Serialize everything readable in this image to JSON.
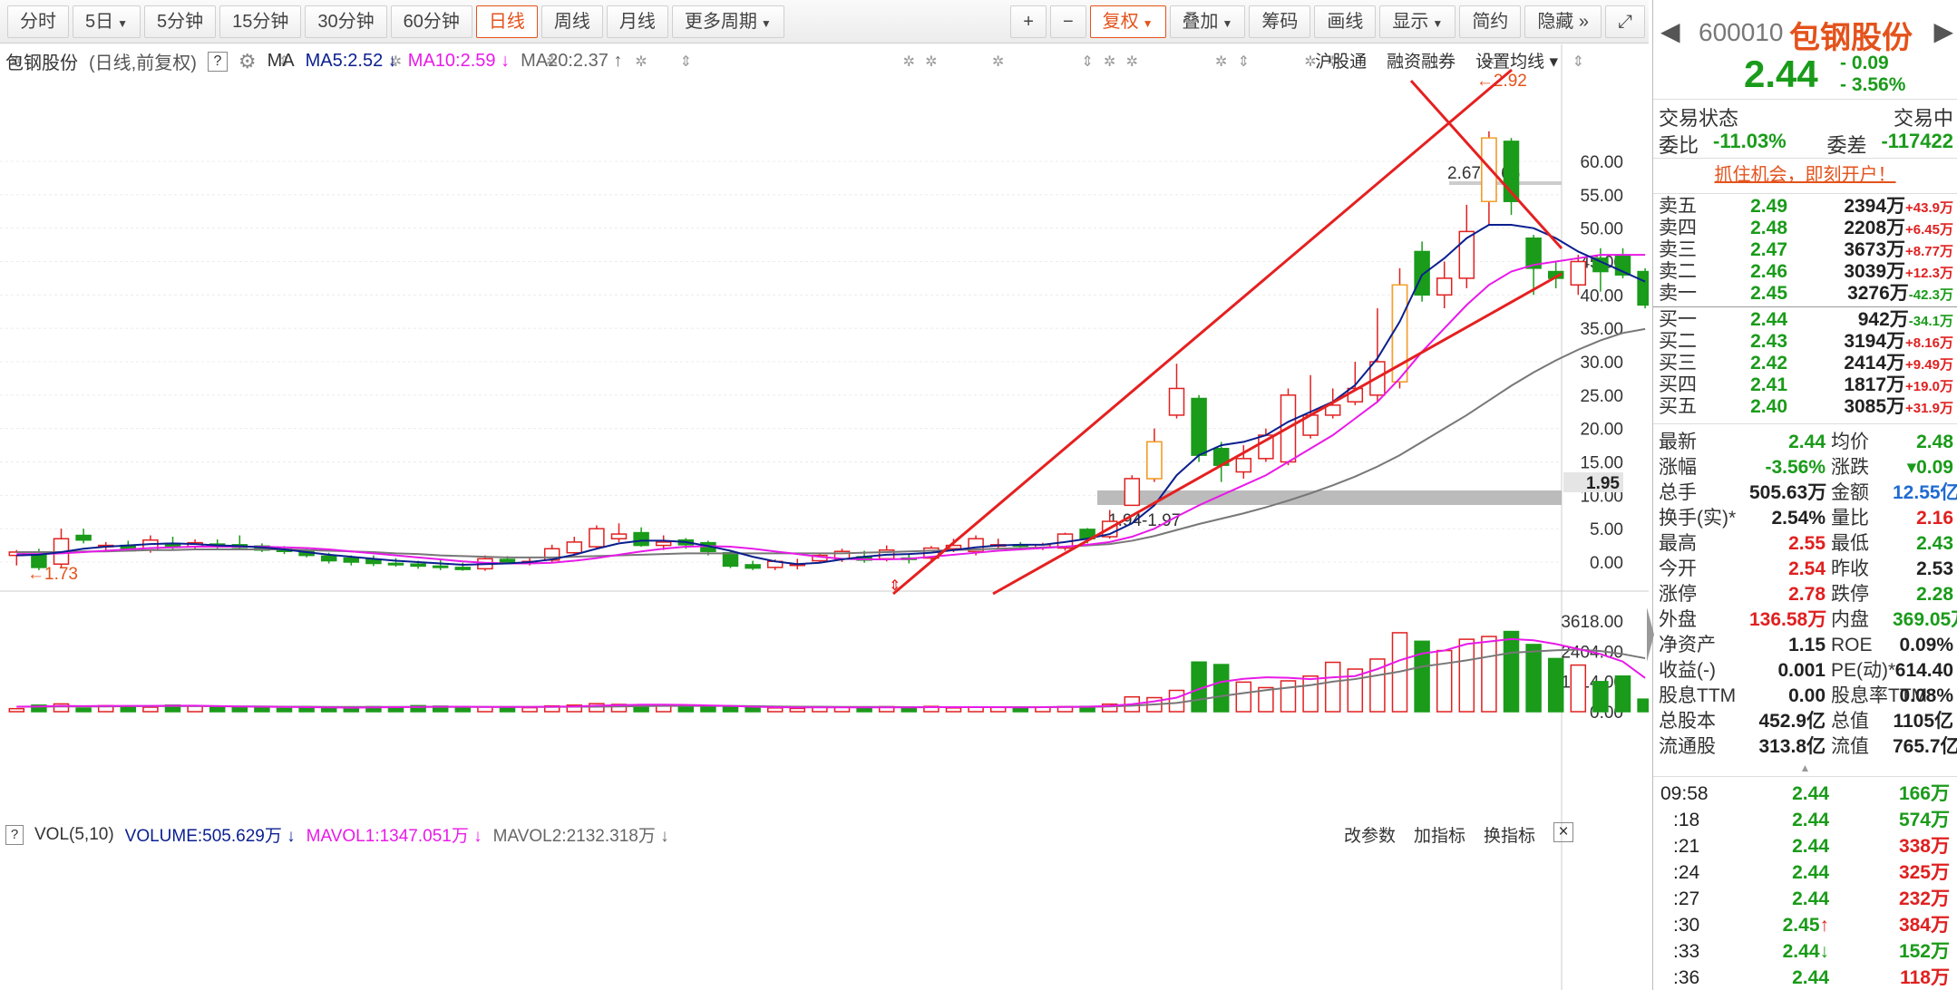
{
  "toolbar": {
    "periods": [
      {
        "label": "分时",
        "caret": false
      },
      {
        "label": "5日",
        "caret": true
      },
      {
        "label": "5分钟",
        "caret": false
      },
      {
        "label": "15分钟",
        "caret": false
      },
      {
        "label": "30分钟",
        "caret": false
      },
      {
        "label": "60分钟",
        "caret": false
      },
      {
        "label": "日线",
        "caret": false,
        "active": true
      },
      {
        "label": "周线",
        "caret": false
      },
      {
        "label": "月线",
        "caret": false
      },
      {
        "label": "更多周期",
        "caret": true
      }
    ],
    "right": [
      {
        "label": "+",
        "caret": false
      },
      {
        "label": "−",
        "caret": false
      },
      {
        "label": "复权",
        "caret": true,
        "active": true
      },
      {
        "label": "叠加",
        "caret": true
      },
      {
        "label": "筹码",
        "caret": false
      },
      {
        "label": "画线",
        "caret": false
      },
      {
        "label": "显示",
        "caret": true
      },
      {
        "label": "简约",
        "caret": false
      },
      {
        "label": "隐藏 »",
        "caret": false
      },
      {
        "label": "⤢",
        "caret": false
      }
    ]
  },
  "legend": {
    "stock": "包钢股份",
    "mode": "(日线,前复权)",
    "help": "?",
    "ma_label": "MA",
    "ma5": "MA5:2.52 ↓",
    "ma10": "MA10:2.59 ↓",
    "ma20": "MA20:2.37 ↑",
    "links": [
      "沪股通",
      "融资融券",
      "设置均线 ▾"
    ]
  },
  "vol_legend": {
    "help": "?",
    "name": "VOL(5,10)",
    "volume": "VOLUME:505.629万 ↓",
    "mavol1": "MAVOL1:1347.051万 ↓",
    "mavol2": "MAVOL2:2132.318万 ↓",
    "links": [
      "改参数",
      "加指标",
      "换指标"
    ],
    "close": "×"
  },
  "chart_data": {
    "type": "candlestick",
    "price_axis": {
      "ticks": [
        0,
        5,
        10,
        15,
        20,
        25,
        30,
        35,
        40,
        45,
        50,
        55,
        60
      ],
      "labels": [
        "0.00",
        "5.00",
        "10.00",
        "15.00",
        "20.00",
        "25.00",
        "30.00",
        "35.00",
        "40.00",
        "45.00",
        "50.00",
        "55.00",
        "60.00"
      ]
    },
    "volume_axis": {
      "ticks": [
        0,
        1214,
        2404,
        3618
      ],
      "labels": [
        "0.00",
        "1214.00",
        "2404.00",
        "3618.00"
      ]
    },
    "current_price_tag": "1.95",
    "annotations": {
      "low_label": "←1.73",
      "high_label": "←2.92",
      "gap_upper": "2.67-2.66",
      "gap_lower": "1.94-1.97"
    },
    "candles": [
      {
        "o": 1.0,
        "h": 1.8,
        "l": -0.5,
        "c": 1.5
      },
      {
        "o": 1.0,
        "h": 2.0,
        "l": -1.2,
        "c": -0.8
      },
      {
        "o": -0.3,
        "h": 5.0,
        "l": -0.8,
        "c": 3.5
      },
      {
        "o": 4.0,
        "h": 5.0,
        "l": 2.8,
        "c": 3.3
      },
      {
        "o": 2.3,
        "h": 3.0,
        "l": 1.8,
        "c": 2.5
      },
      {
        "o": 2.5,
        "h": 3.2,
        "l": 1.6,
        "c": 1.7
      },
      {
        "o": 1.8,
        "h": 4.0,
        "l": 1.4,
        "c": 3.3
      },
      {
        "o": 2.8,
        "h": 3.8,
        "l": 1.8,
        "c": 2.2
      },
      {
        "o": 2.3,
        "h": 3.4,
        "l": 1.8,
        "c": 2.9
      },
      {
        "o": 2.7,
        "h": 3.4,
        "l": 1.9,
        "c": 2.5
      },
      {
        "o": 2.6,
        "h": 4.0,
        "l": 1.9,
        "c": 2.2
      },
      {
        "o": 2.4,
        "h": 2.8,
        "l": 1.5,
        "c": 1.8
      },
      {
        "o": 1.9,
        "h": 2.4,
        "l": 1.2,
        "c": 1.6
      },
      {
        "o": 1.6,
        "h": 2.2,
        "l": 0.7,
        "c": 1.0
      },
      {
        "o": 0.9,
        "h": 1.4,
        "l": -0.2,
        "c": 0.2
      },
      {
        "o": 0.6,
        "h": 1.0,
        "l": -0.5,
        "c": 0.0
      },
      {
        "o": 0.4,
        "h": 1.0,
        "l": -0.6,
        "c": -0.2
      },
      {
        "o": -0.2,
        "h": 0.6,
        "l": -0.7,
        "c": -0.4
      },
      {
        "o": -0.3,
        "h": 0.2,
        "l": -1.0,
        "c": -0.6
      },
      {
        "o": -0.6,
        "h": 0.5,
        "l": -1.2,
        "c": -0.8
      },
      {
        "o": -0.8,
        "h": -0.1,
        "l": -1.3,
        "c": -1.1
      },
      {
        "o": -1.0,
        "h": 1.0,
        "l": -1.3,
        "c": 0.5
      },
      {
        "o": 0.4,
        "h": 0.9,
        "l": -0.3,
        "c": -0.2
      },
      {
        "o": -0.1,
        "h": 0.8,
        "l": -0.5,
        "c": 0.1
      },
      {
        "o": 0.3,
        "h": 2.6,
        "l": -0.2,
        "c": 2.0
      },
      {
        "o": 1.4,
        "h": 3.8,
        "l": 1.0,
        "c": 3.0
      },
      {
        "o": 2.3,
        "h": 5.5,
        "l": 2.0,
        "c": 5.0
      },
      {
        "o": 3.5,
        "h": 5.8,
        "l": 3.0,
        "c": 4.2
      },
      {
        "o": 4.4,
        "h": 5.2,
        "l": 2.3,
        "c": 2.5
      },
      {
        "o": 2.5,
        "h": 4.0,
        "l": 1.8,
        "c": 3.0
      },
      {
        "o": 3.3,
        "h": 3.6,
        "l": 2.0,
        "c": 2.6
      },
      {
        "o": 2.9,
        "h": 3.2,
        "l": 1.0,
        "c": 1.6
      },
      {
        "o": 1.4,
        "h": 1.8,
        "l": -0.9,
        "c": -0.6
      },
      {
        "o": -0.4,
        "h": 0.2,
        "l": -1.2,
        "c": -0.9
      },
      {
        "o": -0.8,
        "h": 0.4,
        "l": -1.2,
        "c": 0.1
      },
      {
        "o": -0.5,
        "h": 0.5,
        "l": -1.1,
        "c": -0.3
      },
      {
        "o": 0.2,
        "h": 1.2,
        "l": -0.2,
        "c": 1.0
      },
      {
        "o": 0.5,
        "h": 2.0,
        "l": 0.0,
        "c": 1.6
      },
      {
        "o": 0.8,
        "h": 1.7,
        "l": -0.1,
        "c": 0.3
      },
      {
        "o": 0.5,
        "h": 2.5,
        "l": 0.1,
        "c": 1.8
      },
      {
        "o": 0.6,
        "h": 1.3,
        "l": -0.2,
        "c": 0.4
      },
      {
        "o": 0.6,
        "h": 2.4,
        "l": 0.2,
        "c": 2.1
      },
      {
        "o": 2.0,
        "h": 3.5,
        "l": 1.5,
        "c": 2.5
      },
      {
        "o": 1.6,
        "h": 4.0,
        "l": 1.0,
        "c": 3.5
      },
      {
        "o": 2.4,
        "h": 3.5,
        "l": 1.9,
        "c": 2.6
      },
      {
        "o": 2.6,
        "h": 3.0,
        "l": 2.2,
        "c": 2.5
      },
      {
        "o": 2.2,
        "h": 2.9,
        "l": 1.8,
        "c": 2.6
      },
      {
        "o": 2.1,
        "h": 4.4,
        "l": 1.7,
        "c": 4.2
      },
      {
        "o": 4.9,
        "h": 5.1,
        "l": 2.8,
        "c": 3.5
      },
      {
        "o": 3.8,
        "h": 7.8,
        "l": 3.5,
        "c": 6.1
      },
      {
        "o": 8.5,
        "h": 13.0,
        "l": 8.5,
        "c": 12.5
      },
      {
        "o": 12.5,
        "h": 20.0,
        "l": 12.0,
        "c": 18.0
      },
      {
        "o": 22.0,
        "h": 29.7,
        "l": 21.5,
        "c": 26.0
      },
      {
        "o": 24.5,
        "h": 25.0,
        "l": 15.0,
        "c": 16.0
      },
      {
        "o": 17.0,
        "h": 18.0,
        "l": 12.0,
        "c": 14.5
      },
      {
        "o": 13.5,
        "h": 17.5,
        "l": 12.5,
        "c": 15.5
      },
      {
        "o": 15.5,
        "h": 20.0,
        "l": 15.0,
        "c": 19.0
      },
      {
        "o": 15.0,
        "h": 26.0,
        "l": 14.5,
        "c": 25.0
      },
      {
        "o": 19.0,
        "h": 28.0,
        "l": 18.5,
        "c": 22.0
      },
      {
        "o": 22.0,
        "h": 26.0,
        "l": 21.5,
        "c": 23.5
      },
      {
        "o": 24.0,
        "h": 30.0,
        "l": 23.5,
        "c": 26.0
      },
      {
        "o": 25.0,
        "h": 38.0,
        "l": 24.0,
        "c": 30.0
      },
      {
        "o": 27.0,
        "h": 44.0,
        "l": 26.0,
        "c": 41.5
      },
      {
        "o": 46.5,
        "h": 48.0,
        "l": 39.0,
        "c": 40.0
      },
      {
        "o": 40.0,
        "h": 45.0,
        "l": 38.0,
        "c": 42.5
      },
      {
        "o": 42.5,
        "h": 53.5,
        "l": 41.0,
        "c": 49.5
      },
      {
        "o": 54.0,
        "h": 64.5,
        "l": 50.5,
        "c": 63.5
      },
      {
        "o": 63.0,
        "h": 63.5,
        "l": 52.0,
        "c": 54.0
      },
      {
        "o": 48.5,
        "h": 49.0,
        "l": 40.0,
        "c": 44.0
      },
      {
        "o": 43.5,
        "h": 45.0,
        "l": 41.0,
        "c": 42.5
      },
      {
        "o": 41.5,
        "h": 46.0,
        "l": 40.0,
        "c": 45.0
      },
      {
        "o": 45.5,
        "h": 47.0,
        "l": 40.5,
        "c": 43.5
      },
      {
        "o": 46.0,
        "h": 47.0,
        "l": 42.5,
        "c": 43.0
      },
      {
        "o": 43.5,
        "h": 44.0,
        "l": 38.0,
        "c": 38.5
      }
    ],
    "ma5": [
      1.0,
      1.1,
      1.5,
      2.0,
      2.3,
      2.5,
      2.7,
      2.8,
      2.7,
      2.5,
      2.4,
      2.2,
      1.9,
      1.5,
      1.1,
      0.8,
      0.5,
      0.2,
      0.0,
      -0.2,
      -0.4,
      -0.3,
      -0.2,
      0.0,
      0.4,
      1.1,
      2.0,
      2.8,
      3.2,
      3.2,
      3.0,
      2.4,
      1.7,
      0.8,
      0.1,
      -0.3,
      -0.1,
      0.4,
      0.8,
      1.1,
      1.2,
      1.4,
      1.8,
      2.2,
      2.5,
      2.6,
      2.6,
      3.0,
      3.5,
      4.2,
      5.8,
      8.5,
      13.0,
      16.0,
      17.5,
      18.0,
      19.0,
      21.0,
      22.5,
      24.0,
      26.5,
      30.5,
      36.0,
      43.0,
      45.5,
      48.5,
      50.5,
      50.5,
      50.0,
      48.5,
      46.5,
      45.0,
      43.5,
      42.0
    ],
    "ma10": [
      1.2,
      1.2,
      1.3,
      1.5,
      1.7,
      1.9,
      2.1,
      2.2,
      2.3,
      2.3,
      2.3,
      2.3,
      2.2,
      2.1,
      1.9,
      1.6,
      1.3,
      1.0,
      0.7,
      0.4,
      0.1,
      -0.1,
      -0.2,
      -0.2,
      -0.1,
      0.2,
      0.6,
      1.1,
      1.6,
      2.0,
      2.3,
      2.4,
      2.3,
      2.0,
      1.6,
      1.2,
      0.8,
      0.5,
      0.4,
      0.4,
      0.5,
      0.8,
      1.1,
      1.4,
      1.7,
      1.9,
      2.1,
      2.3,
      2.6,
      3.0,
      3.8,
      5.0,
      6.8,
      8.5,
      10.0,
      11.5,
      13.0,
      15.0,
      17.0,
      19.0,
      21.5,
      24.0,
      27.5,
      31.5,
      35.0,
      38.5,
      41.5,
      43.5,
      44.5,
      45.0,
      45.5,
      46.0,
      46.0,
      46.0
    ],
    "ma20": [
      1.5,
      1.5,
      1.5,
      1.6,
      1.6,
      1.7,
      1.8,
      1.8,
      1.9,
      1.9,
      1.9,
      1.9,
      1.9,
      1.8,
      1.7,
      1.6,
      1.5,
      1.3,
      1.2,
      1.0,
      0.9,
      0.8,
      0.7,
      0.7,
      0.7,
      0.8,
      0.9,
      1.0,
      1.1,
      1.2,
      1.3,
      1.3,
      1.3,
      1.3,
      1.3,
      1.3,
      1.3,
      1.3,
      1.4,
      1.5,
      1.6,
      1.7,
      1.8,
      1.9,
      2.0,
      2.1,
      2.2,
      2.3,
      2.5,
      2.7,
      3.2,
      3.9,
      4.8,
      5.7,
      6.5,
      7.3,
      8.2,
      9.2,
      10.3,
      11.5,
      12.8,
      14.3,
      16.0,
      18.0,
      20.0,
      22.0,
      24.2,
      26.4,
      28.4,
      30.2,
      31.8,
      33.2,
      34.3,
      34.9
    ],
    "volume": [
      120,
      260,
      310,
      140,
      240,
      220,
      180,
      260,
      230,
      200,
      180,
      150,
      130,
      170,
      150,
      130,
      200,
      180,
      240,
      220,
      160,
      190,
      180,
      160,
      230,
      260,
      320,
      290,
      280,
      250,
      210,
      220,
      200,
      160,
      150,
      130,
      180,
      180,
      150,
      200,
      160,
      210,
      150,
      180,
      170,
      150,
      190,
      200,
      210,
      300,
      590,
      560,
      850,
      1980,
      1880,
      1180,
      960,
      1230,
      1420,
      1970,
      1700,
      2100,
      3150,
      2810,
      2440,
      2890,
      3000,
      3200,
      2680,
      2120,
      1860,
      1200,
      1420,
      500
    ],
    "mavol1": [
      200,
      210,
      230,
      220,
      230,
      230,
      230,
      240,
      240,
      220,
      210,
      200,
      190,
      180,
      170,
      160,
      170,
      180,
      190,
      200,
      200,
      190,
      190,
      190,
      200,
      210,
      240,
      260,
      280,
      280,
      270,
      250,
      230,
      200,
      180,
      170,
      170,
      170,
      170,
      170,
      170,
      180,
      180,
      180,
      180,
      170,
      180,
      190,
      200,
      230,
      300,
      410,
      560,
      900,
      1190,
      1310,
      1370,
      1350,
      1300,
      1370,
      1420,
      1700,
      2050,
      2320,
      2440,
      2700,
      2800,
      2900,
      2850,
      2700,
      2500,
      2300,
      2000,
      1347
    ],
    "mavol2": [
      200,
      200,
      210,
      210,
      210,
      220,
      220,
      220,
      220,
      220,
      210,
      210,
      200,
      200,
      190,
      190,
      190,
      190,
      190,
      190,
      190,
      190,
      190,
      190,
      190,
      200,
      200,
      210,
      220,
      230,
      230,
      230,
      230,
      220,
      210,
      200,
      200,
      190,
      190,
      190,
      180,
      180,
      180,
      180,
      180,
      180,
      180,
      190,
      190,
      210,
      240,
      290,
      350,
      480,
      620,
      740,
      860,
      960,
      1060,
      1200,
      1300,
      1450,
      1600,
      1800,
      1920,
      2050,
      2200,
      2350,
      2400,
      2450,
      2480,
      2420,
      2300,
      2132
    ]
  },
  "quote": {
    "code": "600010",
    "name": "包钢股份",
    "price": "2.44",
    "change": "- 0.09",
    "change_pct": "- 3.56%",
    "trade_status_label": "交易状态",
    "trade_status": "交易中",
    "weibi_label": "委比",
    "weibi": "-11.03%",
    "weicha_label": "委差",
    "weicha": "-117422",
    "promo": "抓住机会，即刻开户！",
    "asks": [
      {
        "label": "卖五",
        "price": "2.49",
        "vol": "2394万",
        "delta": "+43.9万",
        "up": true
      },
      {
        "label": "卖四",
        "price": "2.48",
        "vol": "2208万",
        "delta": "+6.45万",
        "up": true
      },
      {
        "label": "卖三",
        "price": "2.47",
        "vol": "3673万",
        "delta": "+8.77万",
        "up": true
      },
      {
        "label": "卖二",
        "price": "2.46",
        "vol": "3039万",
        "delta": "+12.3万",
        "up": true
      },
      {
        "label": "卖一",
        "price": "2.45",
        "vol": "3276万",
        "delta": "-42.3万",
        "up": false
      }
    ],
    "bids": [
      {
        "label": "买一",
        "price": "2.44",
        "vol": "942万",
        "delta": "-34.1万",
        "up": false
      },
      {
        "label": "买二",
        "price": "2.43",
        "vol": "3194万",
        "delta": "+8.16万",
        "up": true
      },
      {
        "label": "买三",
        "price": "2.42",
        "vol": "2414万",
        "delta": "+9.49万",
        "up": true
      },
      {
        "label": "买四",
        "price": "2.41",
        "vol": "1817万",
        "delta": "+19.0万",
        "up": true
      },
      {
        "label": "买五",
        "price": "2.40",
        "vol": "3085万",
        "delta": "+31.9万",
        "up": true
      }
    ],
    "stats": [
      {
        "l1": "最新",
        "v1": "2.44",
        "c1": "green",
        "l2": "均价",
        "v2": "2.48",
        "c2": "green"
      },
      {
        "l1": "涨幅",
        "v1": "-3.56%",
        "c1": "green",
        "l2": "涨跌",
        "v2": "▾0.09",
        "c2": "green"
      },
      {
        "l1": "总手",
        "v1": "505.63万",
        "c1": "dark",
        "l2": "金额",
        "v2": "12.55亿",
        "c2": "blue"
      },
      {
        "l1": "换手(实)*",
        "v1": "2.54%",
        "c1": "dark",
        "l2": "量比",
        "v2": "2.16",
        "c2": "red"
      },
      {
        "l1": "最高",
        "v1": "2.55",
        "c1": "red",
        "l2": "最低",
        "v2": "2.43",
        "c2": "green"
      },
      {
        "l1": "今开",
        "v1": "2.54",
        "c1": "red",
        "l2": "昨收",
        "v2": "2.53",
        "c2": "dark"
      },
      {
        "l1": "涨停",
        "v1": "2.78",
        "c1": "red",
        "l2": "跌停",
        "v2": "2.28",
        "c2": "green"
      },
      {
        "l1": "外盘",
        "v1": "136.58万",
        "c1": "red",
        "l2": "内盘",
        "v2": "369.05万",
        "c2": "green"
      },
      {
        "l1": "净资产",
        "v1": "1.15",
        "c1": "dark",
        "l2": "ROE",
        "v2": "0.09%",
        "c2": "dark"
      },
      {
        "l1": "收益(-)",
        "v1": "0.001",
        "c1": "dark",
        "l2": "PE(动)*",
        "v2": "614.40",
        "c2": "dark"
      },
      {
        "l1": "股息TTM",
        "v1": "0.00",
        "c1": "dark",
        "l2": "股息率TTM",
        "v2": "0.08%",
        "c2": "dark"
      },
      {
        "l1": "总股本",
        "v1": "452.9亿",
        "c1": "dark",
        "l2": "总值",
        "v2": "1105亿",
        "c2": "dark"
      },
      {
        "l1": "流通股",
        "v1": "313.8亿",
        "c1": "dark",
        "l2": "流值",
        "v2": "765.7亿",
        "c2": "dark"
      }
    ],
    "ticks": [
      {
        "time": "09:58",
        "price": "2.44",
        "arrow": "",
        "vol": "166万",
        "up": false
      },
      {
        "time": ":18",
        "price": "2.44",
        "arrow": "",
        "vol": "574万",
        "up": false
      },
      {
        "time": ":21",
        "price": "2.44",
        "arrow": "",
        "vol": "338万",
        "up": true
      },
      {
        "time": ":24",
        "price": "2.44",
        "arrow": "",
        "vol": "325万",
        "up": true
      },
      {
        "time": ":27",
        "price": "2.44",
        "arrow": "",
        "vol": "232万",
        "up": true
      },
      {
        "time": ":30",
        "price": "2.45",
        "arrow": "↑",
        "vol": "384万",
        "up": true
      },
      {
        "time": ":33",
        "price": "2.44",
        "arrow": "↓",
        "vol": "152万",
        "up": false
      },
      {
        "time": ":36",
        "price": "2.44",
        "arrow": "",
        "vol": "118万",
        "up": true
      }
    ]
  },
  "colors": {
    "up": "#e02020",
    "down": "#1a9b1a",
    "ma5": "#0a1f8f",
    "ma10": "#e81ae8",
    "ma20": "#777777",
    "accent": "#e4521b"
  }
}
